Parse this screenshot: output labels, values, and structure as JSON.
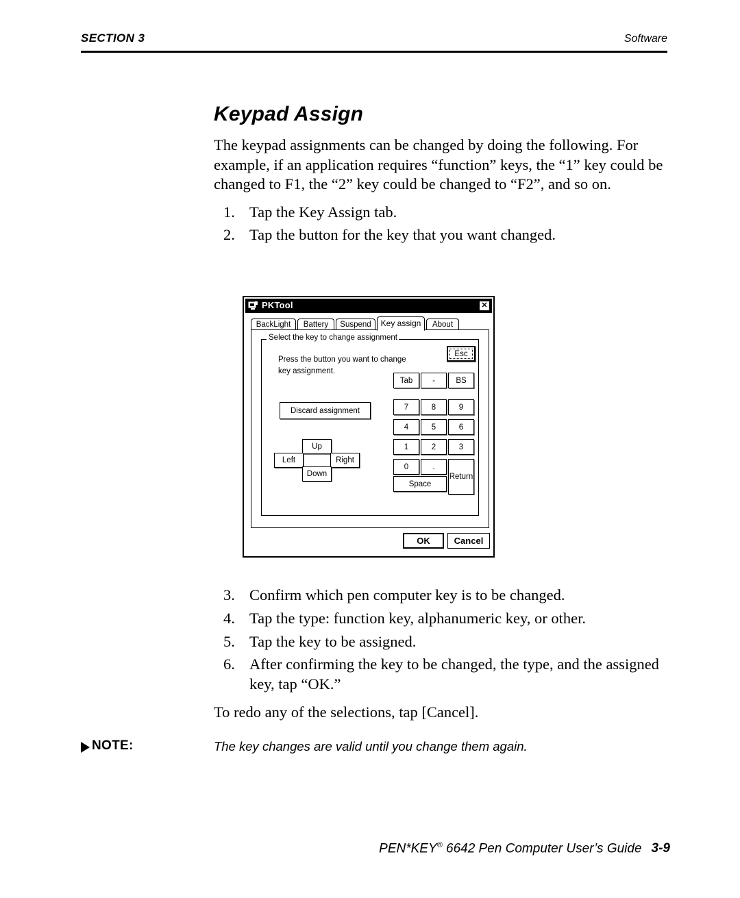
{
  "header": {
    "section": "SECTION 3",
    "running_head": "Software"
  },
  "main": {
    "title": "Keypad Assign",
    "intro": "The keypad assignments can be changed by doing the following.  For example, if an application requires “function” keys, the “1” key could be changed to F1, the “2” key could be changed to “F2”, and so on.",
    "steps": [
      {
        "num": "1.",
        "text": "Tap the Key Assign tab."
      },
      {
        "num": "2.",
        "text": "Tap the button for the key that you want changed."
      },
      {
        "num": "3.",
        "text": "Confirm which pen computer key is to be changed."
      },
      {
        "num": "4.",
        "text": "Tap the type: function key, alphanumeric key, or other."
      },
      {
        "num": "5.",
        "text": "Tap the key to be assigned."
      },
      {
        "num": "6.",
        "text": "After confirming the key to be changed, the type, and the assigned key, tap “OK.”"
      }
    ],
    "redo": "To redo any of the selections, tap [Cancel]."
  },
  "note": {
    "label": "NOTE:",
    "text": "The key changes are valid until you change them again."
  },
  "footer": {
    "product": "PEN*KEY",
    "registered": "®",
    "guide": " 6642 Pen Computer User’s Guide",
    "page": "3-9"
  },
  "dialog": {
    "title": "PKTool",
    "close_label": "✕",
    "tabs": [
      {
        "label": "BackLight",
        "active": false
      },
      {
        "label": "Battery",
        "active": false
      },
      {
        "label": "Suspend",
        "active": false
      },
      {
        "label": "Key assign",
        "active": true
      },
      {
        "label": "About",
        "active": false
      }
    ],
    "group_legend": "Select the key to change assignment",
    "hint_line1": "Press the button you want to change",
    "hint_line2": "key assignment.",
    "discard_label": "Discard assignment",
    "arrows": {
      "up": "Up",
      "left": "Left",
      "right": "Right",
      "down": "Down"
    },
    "keypad": {
      "esc": "Esc",
      "tab": "Tab",
      "dash": "-",
      "bs": "BS",
      "seven": "7",
      "eight": "8",
      "nine": "9",
      "four": "4",
      "five": "5",
      "six": "6",
      "one": "1",
      "two": "2",
      "three": "3",
      "zero": "0",
      "dot": ".",
      "return": "Return",
      "space": "Space"
    },
    "ok_label": "OK",
    "cancel_label": "Cancel"
  }
}
